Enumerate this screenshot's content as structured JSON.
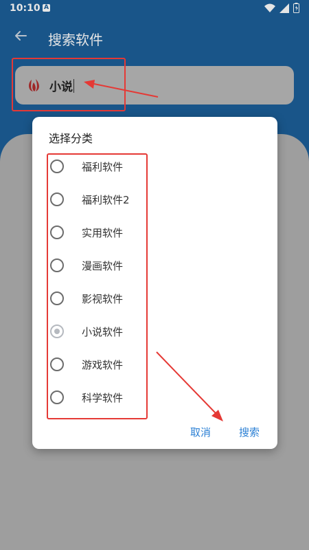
{
  "status_bar": {
    "time": "10:10"
  },
  "toolbar": {
    "title": "搜索软件"
  },
  "search": {
    "value": "小说"
  },
  "dialog": {
    "title": "选择分类",
    "options": [
      {
        "label": "福利软件",
        "checked": false
      },
      {
        "label": "福利软件2",
        "checked": false
      },
      {
        "label": "实用软件",
        "checked": false
      },
      {
        "label": "漫画软件",
        "checked": false
      },
      {
        "label": "影视软件",
        "checked": false
      },
      {
        "label": "小说软件",
        "checked": true
      },
      {
        "label": "游戏软件",
        "checked": false
      },
      {
        "label": "科学软件",
        "checked": false
      }
    ],
    "cancel_label": "取消",
    "search_label": "搜索"
  },
  "colors": {
    "app_bar": "#1c5f99",
    "dialog_button": "#2a7fd4",
    "annotation": "#e53935"
  },
  "icons": [
    "back-arrow-icon",
    "app-logo-icon",
    "wifi-icon",
    "signal-icon",
    "battery-icon"
  ]
}
